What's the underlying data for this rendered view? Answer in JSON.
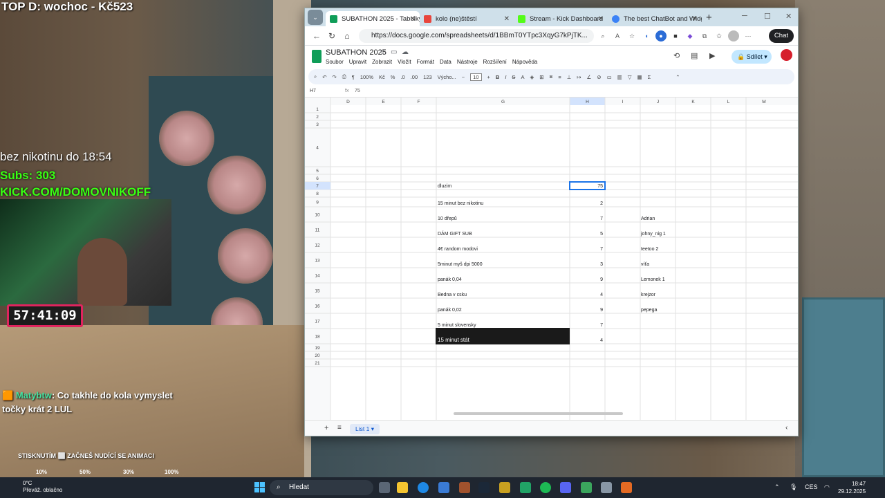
{
  "overlay": {
    "top_donor": "TOP D: wochoc - Kč523",
    "nicotine": "bez nikotinu do 18:54",
    "subs": "Subs: 303",
    "kick": "KICK.COM/DOMOVNIKOFF",
    "timer": "57:41:09",
    "chat_user": "Matybtw",
    "chat_message_1": ": Co takhle do kola vymyslet",
    "chat_message_2": "točky krát 2 LUL",
    "hint": "STISKNUTÍM ⬜ ZAČNEŠ NUDÍCÍ SE ANIMACI",
    "stats": [
      "10%",
      "50%",
      "30%",
      "100%"
    ]
  },
  "browser": {
    "tabs": [
      {
        "title": "SUBATHON 2025 - Tabulky Go",
        "icon_color": "#0f9d58",
        "active": true
      },
      {
        "title": "kolo (ne)štěstí",
        "icon_color": "#e8453c",
        "active": false
      },
      {
        "title": "Stream - Kick Dashboard",
        "icon_color": "#53fc18",
        "active": false
      },
      {
        "title": "The best ChatBot and Widge",
        "icon_color": "#3b82f6",
        "active": false
      }
    ],
    "url": "https://docs.google.com/spreadsheets/d/1BBmT0YTpc3XqyG7kPjTK...",
    "chat_button": "Chat"
  },
  "sheets": {
    "title": "SUBATHON 2025",
    "menu": [
      "Soubor",
      "Upravit",
      "Zobrazit",
      "Vložit",
      "Formát",
      "Data",
      "Nástroje",
      "Rozšíření",
      "Nápověda"
    ],
    "share": "Sdílet",
    "toolbar": {
      "zoom": "100%",
      "currency": "Kč",
      "percent": "%",
      "dec_less": ".0",
      "dec_more": ".00",
      "number_format": "123",
      "font": "Výcho...",
      "font_size": "10"
    },
    "cell_ref": "H7",
    "formula_value": "75",
    "columns": [
      "D",
      "E",
      "F",
      "G",
      "H",
      "I",
      "J",
      "K",
      "L",
      "M"
    ],
    "rows": [
      "1",
      "2",
      "3",
      "4",
      "5",
      "6",
      "7",
      "8",
      "9",
      "10",
      "11",
      "12",
      "13",
      "14",
      "15",
      "16",
      "17",
      "18",
      "19",
      "20",
      "21"
    ],
    "cells": [
      {
        "row": 7,
        "g": "dluzim",
        "h": "75",
        "j": ""
      },
      {
        "row": 9,
        "g": "15 minut bez nikotinu",
        "h": "2",
        "j": ""
      },
      {
        "row": 10,
        "g": "10 dřepů",
        "h": "7",
        "j": "Adrian"
      },
      {
        "row": 11,
        "g": "DÁM GIFT SUB",
        "h": "5",
        "j": "johny_nig 1"
      },
      {
        "row": 12,
        "g": "4€ random modovi",
        "h": "7",
        "j": "teetoo 2"
      },
      {
        "row": 13,
        "g": "5minut myš dpi 5000",
        "h": "3",
        "j": "víťa"
      },
      {
        "row": 14,
        "g": "panák 0,04",
        "h": "9",
        "j": "Lemonek 1"
      },
      {
        "row": 15,
        "g": "Bedna v csku",
        "h": "4",
        "j": "krejzor"
      },
      {
        "row": 16,
        "g": "panák 0,02",
        "h": "9",
        "j": "pepega"
      },
      {
        "row": 17,
        "g": "5 minut slovensky",
        "h": "7",
        "j": ""
      },
      {
        "row": 18,
        "g": "15 minut stát",
        "h": "4",
        "j": ""
      }
    ],
    "sheet_tab": "List 1"
  },
  "taskbar": {
    "temp": "0°C",
    "weather": "Převáž. oblačno",
    "search": "Hledat",
    "lang": "CES",
    "time": "18:47",
    "date": "29.12.2025"
  }
}
